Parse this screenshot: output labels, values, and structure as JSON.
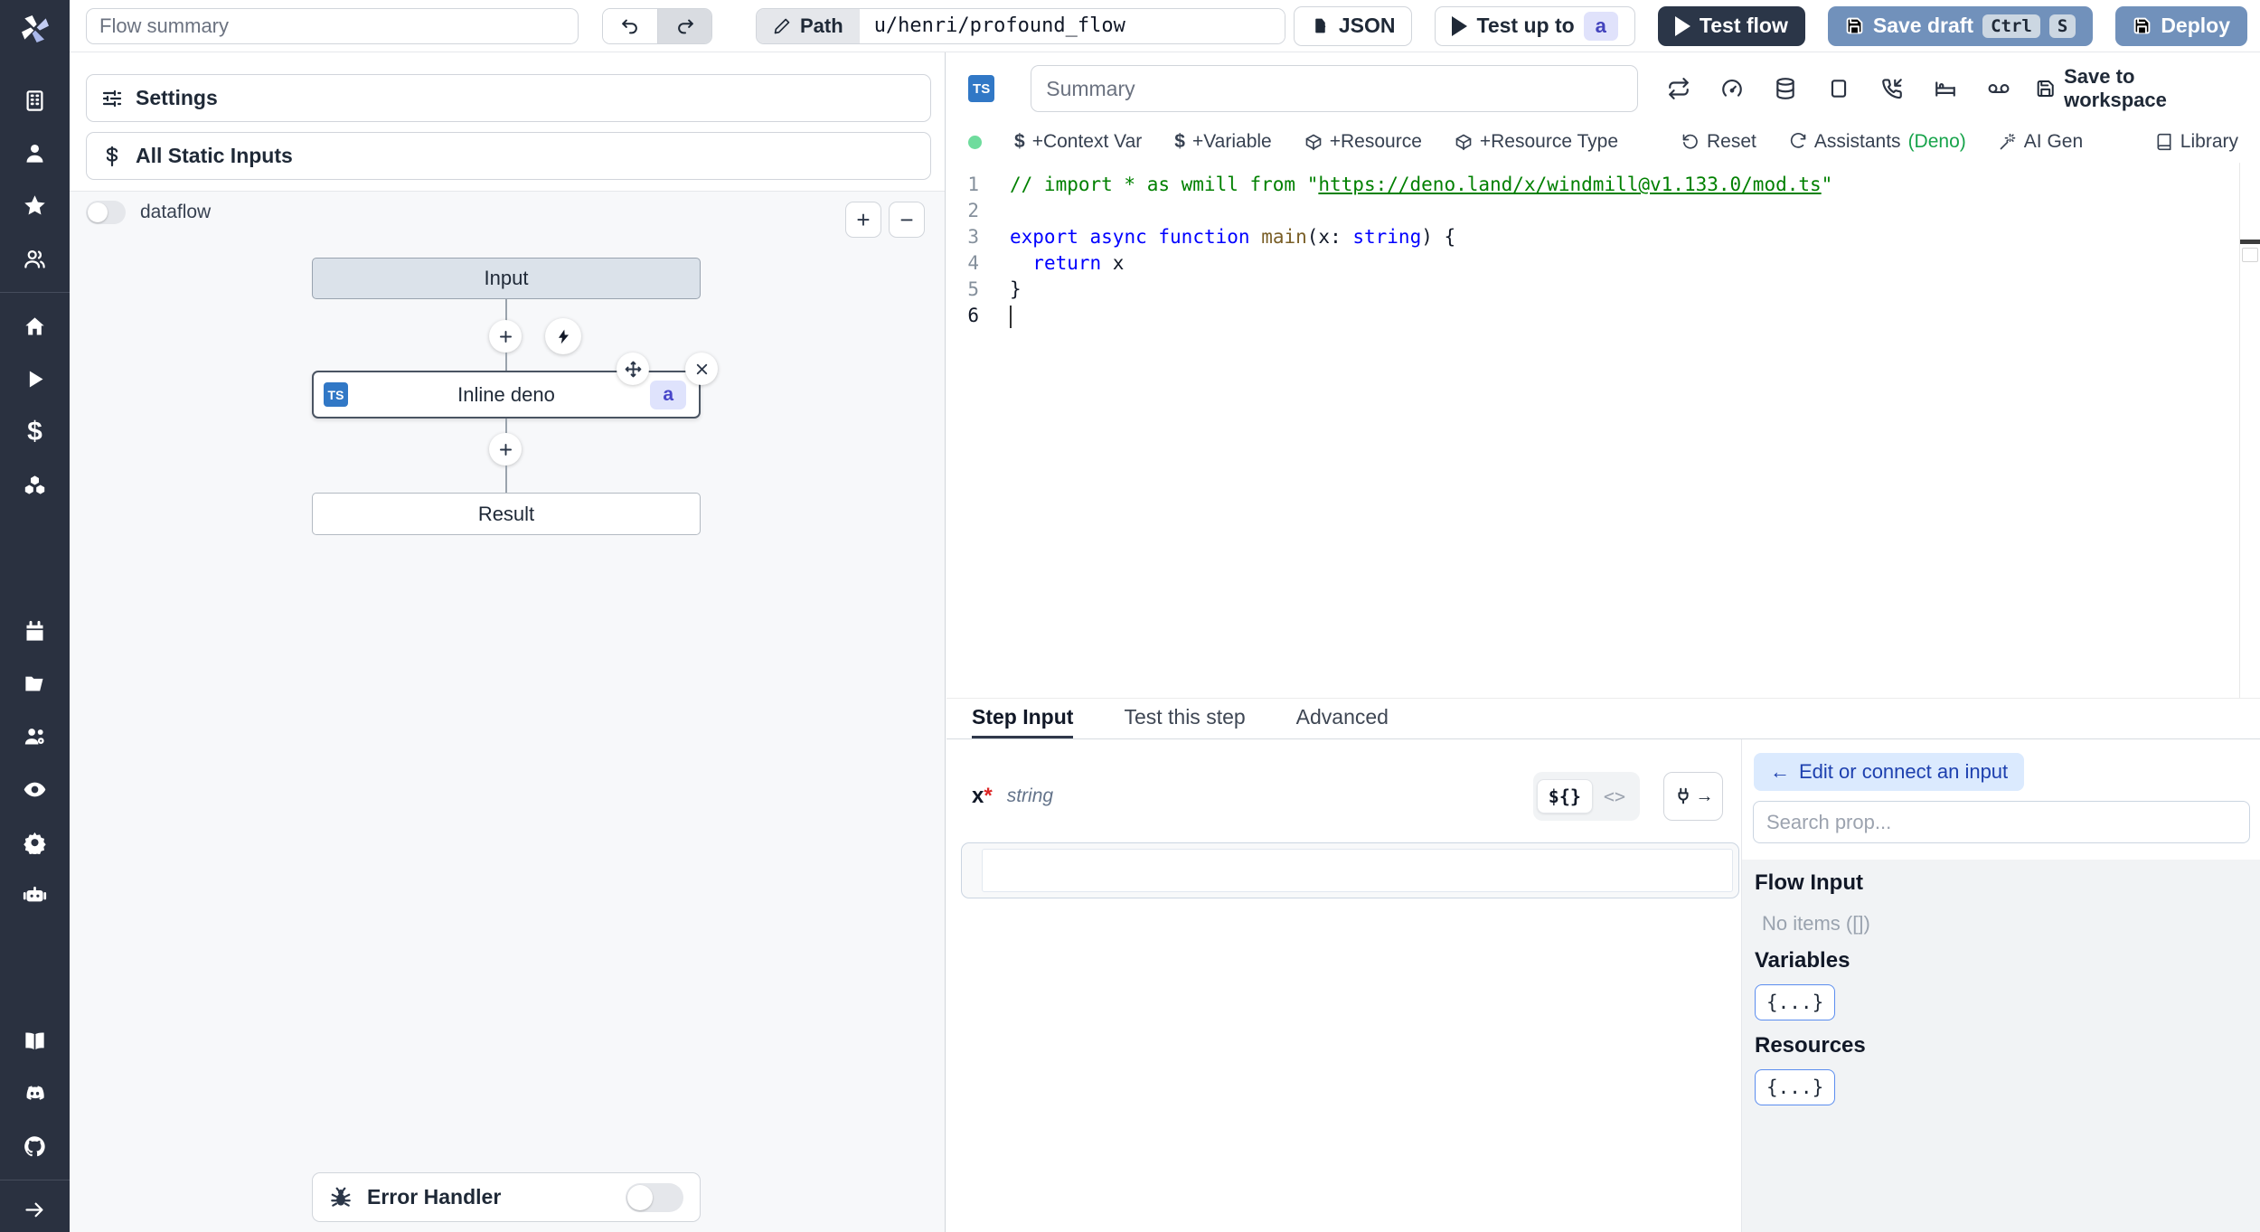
{
  "topbar": {
    "flow_summary_placeholder": "Flow summary",
    "path_label": "Path",
    "path_value": "u/henri/profound_flow",
    "json_label": "JSON",
    "test_up_to_label": "Test up to",
    "test_up_to_badge": "a",
    "test_flow_label": "Test flow",
    "save_draft_label": "Save draft",
    "save_draft_kbd1": "Ctrl",
    "save_draft_kbd2": "S",
    "deploy_label": "Deploy"
  },
  "sidebar": {
    "icons": [
      "windmill-logo",
      "building",
      "user",
      "star",
      "users",
      "home",
      "play",
      "dollar",
      "cubes",
      "calendar",
      "folder",
      "users-cog",
      "eye",
      "gear",
      "robot",
      "book",
      "discord",
      "github",
      "expand-arrow"
    ]
  },
  "flow_panel": {
    "settings_label": "Settings",
    "static_inputs_label": "All Static Inputs",
    "dataflow_label": "dataflow",
    "zoom_in": "+",
    "zoom_out": "−",
    "nodes": {
      "input_label": "Input",
      "step_label": "Inline deno",
      "step_lang_badge": "TS",
      "step_id_badge": "a",
      "result_label": "Result"
    },
    "error_handler_label": "Error Handler"
  },
  "editor": {
    "lang_badge": "TS",
    "summary_placeholder": "Summary",
    "save_to_workspace_label": "Save to workspace",
    "toolbar": {
      "context_var": "+Context Var",
      "variable": "+Variable",
      "resource": "+Resource",
      "resource_type": "+Resource Type",
      "reset": "Reset",
      "assistants": "Assistants",
      "assistants_lang": "(Deno)",
      "ai_gen": "AI Gen",
      "library": "Library",
      "dollar_sign": "$"
    },
    "code": {
      "lines": [
        [
          [
            "cmt",
            "// import * as wmill from \""
          ],
          [
            "cmt-link",
            "https://deno.land/x/windmill@v1.133.0/mod.ts"
          ],
          [
            "cmt",
            "\""
          ]
        ],
        [],
        [
          [
            "kw",
            "export"
          ],
          [
            "pl",
            " "
          ],
          [
            "kw",
            "async"
          ],
          [
            "pl",
            " "
          ],
          [
            "kw",
            "function"
          ],
          [
            "pl",
            " "
          ],
          [
            "fn",
            "main"
          ],
          [
            "pl",
            "(x: "
          ],
          [
            "kw",
            "string"
          ],
          [
            "pl",
            ") {"
          ]
        ],
        [
          [
            "pl",
            "  "
          ],
          [
            "kw",
            "return"
          ],
          [
            "pl",
            " x"
          ]
        ],
        [
          [
            "pl",
            "}"
          ]
        ],
        [
          [
            "cursor",
            ""
          ]
        ]
      ]
    }
  },
  "tabs": {
    "step_input": "Step Input",
    "test_this_step": "Test this step",
    "advanced": "Advanced"
  },
  "step_input": {
    "field_name": "x",
    "required_mark": "*",
    "field_type": "string",
    "value": "",
    "json_toggle": "${}",
    "code_toggle": "<>",
    "plug_arrow": "→"
  },
  "connect_panel": {
    "back_arrow": "←",
    "back_label": "Edit or connect an input",
    "search_placeholder": "Search prop...",
    "flow_input_title": "Flow Input",
    "flow_input_empty": "No items ([])",
    "variables_title": "Variables",
    "variables_button": "{...}",
    "resources_title": "Resources",
    "resources_button": "{...}"
  },
  "colors": {
    "sidebar_bg": "#2a3140",
    "steel_blue": "#7191bb",
    "navy": "#2b3648",
    "ts_blue": "#3178c6",
    "badge_bg": "#dfe3fc",
    "badge_text": "#4846c9",
    "pill_bg": "#dbeafe",
    "pill_text": "#1d40af",
    "status_green": "#6fdc9d",
    "code_comment": "#008000",
    "code_keyword": "#0000ff"
  }
}
